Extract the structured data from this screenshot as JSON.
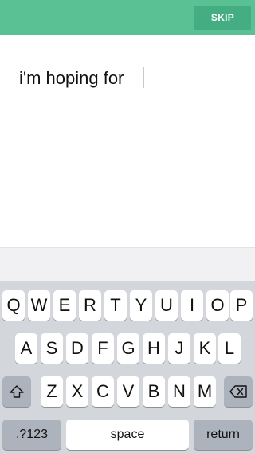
{
  "header": {
    "skip_label": "SKIP"
  },
  "input": {
    "text": "i'm hoping for "
  },
  "keyboard": {
    "row1": [
      "Q",
      "W",
      "E",
      "R",
      "T",
      "Y",
      "U",
      "I",
      "O",
      "P"
    ],
    "row2": [
      "A",
      "S",
      "D",
      "F",
      "G",
      "H",
      "J",
      "K",
      "L"
    ],
    "row3": [
      "Z",
      "X",
      "C",
      "V",
      "B",
      "N",
      "M"
    ],
    "shift_icon": "shift-icon",
    "delete_icon": "delete-icon",
    "numbers_label": ".?123",
    "space_label": "space",
    "return_label": "return"
  },
  "colors": {
    "accent": "#5ac195",
    "accent_dark": "#44ad82",
    "keyboard_bg": "#d3d6db",
    "key_bg": "#ffffff",
    "fn_key_bg": "#adb3bd"
  }
}
